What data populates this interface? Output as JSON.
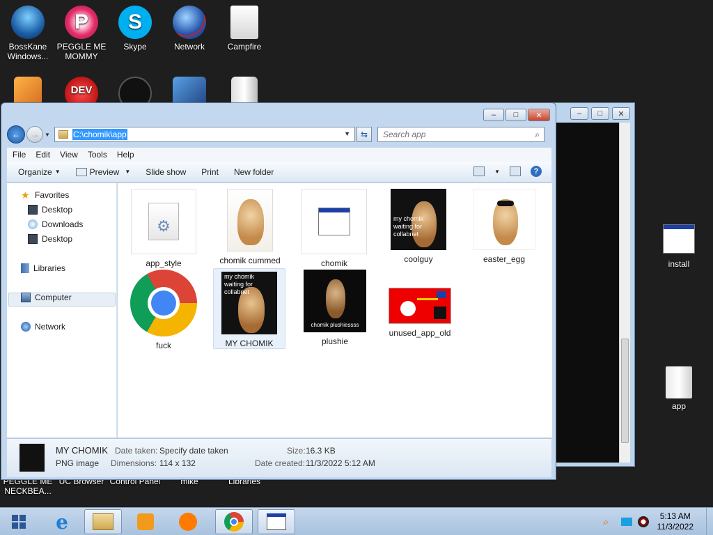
{
  "desktop": {
    "top_icons": [
      {
        "label": "BossKane Windows..."
      },
      {
        "label": "PEGGLE ME MOMMY"
      },
      {
        "label": "Skype"
      },
      {
        "label": "Network"
      },
      {
        "label": "Campfire"
      }
    ],
    "hidden_row_labels": [
      "PEGGLE ME NECKBEA...",
      "UC Browser",
      "Control Panel",
      "mike",
      "Libraries"
    ],
    "right_icons": [
      {
        "label": "install"
      },
      {
        "label": "app"
      }
    ]
  },
  "explorer": {
    "address": "C:\\chomik\\app",
    "search_placeholder": "Search app",
    "menu": [
      "File",
      "Edit",
      "View",
      "Tools",
      "Help"
    ],
    "toolbar": {
      "organize": "Organize",
      "preview": "Preview",
      "slideshow": "Slide show",
      "print": "Print",
      "new_folder": "New folder"
    },
    "nav": {
      "favorites": "Favorites",
      "fav_items": [
        "Desktop",
        "Downloads",
        "Desktop"
      ],
      "libraries": "Libraries",
      "computer": "Computer",
      "network": "Network"
    },
    "files": [
      {
        "name": "app_style"
      },
      {
        "name": "chomik cummed"
      },
      {
        "name": "chomik"
      },
      {
        "name": "coolguy",
        "overlay": "my chomik waiting for collabnet"
      },
      {
        "name": "easter_egg"
      },
      {
        "name": "fuck"
      },
      {
        "name": "MY CHOMIK",
        "overlay": "my chomik waiting for collabnet"
      },
      {
        "name": "plushie",
        "overlay": "chomik plushiessss"
      },
      {
        "name": "unused_app_old"
      }
    ],
    "details": {
      "name": "MY CHOMIK",
      "type": "PNG image",
      "date_taken_label": "Date taken:",
      "date_taken": "Specify date taken",
      "dimensions_label": "Dimensions:",
      "dimensions": "114 x 132",
      "size_label": "Size:",
      "size": "16.3 KB",
      "created_label": "Date created:",
      "created": "11/3/2022 5:12 AM"
    }
  },
  "taskbar": {
    "time": "5:13 AM",
    "date": "11/3/2022"
  },
  "colors": {
    "selection": "#3399ff",
    "window_frame": "#c3d7ee",
    "taskbar": "#b8cde6"
  }
}
